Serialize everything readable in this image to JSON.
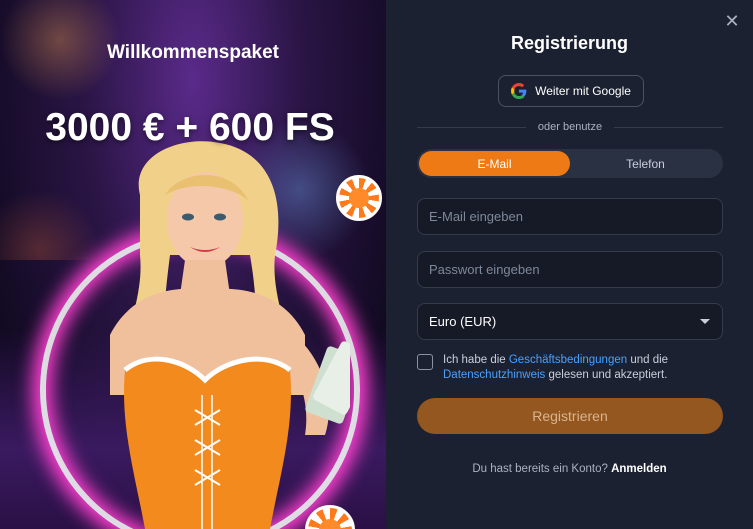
{
  "promo": {
    "title": "Willkommenspaket",
    "amount": "3000 € + 600 FS"
  },
  "form": {
    "title": "Registrierung",
    "google_label": "Weiter mit Google",
    "divider_text": "oder benutze",
    "tabs": [
      {
        "label": "E-Mail",
        "active": true
      },
      {
        "label": "Telefon",
        "active": false
      }
    ],
    "email_placeholder": "E-Mail eingeben",
    "password_placeholder": "Passwort eingeben",
    "currency_value": "Euro (EUR)",
    "terms": {
      "part1": "Ich habe die ",
      "link1": "Geschäftsbedingungen",
      "part2": " und die ",
      "link2": "Datenschutzhinweis",
      "part3": " gelesen und akzeptiert."
    },
    "register_label": "Registrieren",
    "login_prompt": "Du hast bereits ein Konto? ",
    "login_link": "Anmelden"
  },
  "colors": {
    "accent": "#ee7a15",
    "panel_bg": "#1b2130",
    "link": "#4aa0ff"
  }
}
